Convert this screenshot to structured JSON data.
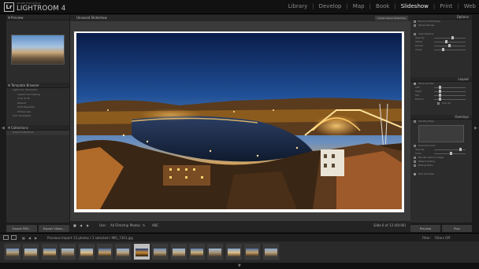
{
  "app": {
    "logo": "Lr",
    "brand_small": "ADOBE PHOTOSHOP",
    "brand": "LIGHTROOM 4",
    "modules": [
      "Library",
      "Develop",
      "Map",
      "Book",
      "Slideshow",
      "Print",
      "Web"
    ],
    "active_module": "Slideshow"
  },
  "left_panel": {
    "preview_header": "Preview",
    "template_browser_header": "Template Browser",
    "template_items": [
      "Lightroom Templates",
      "Caption and Rating",
      "Crop To Fill",
      "Default",
      "EXIF Metadata",
      "Widescreen",
      "User Templates"
    ],
    "collections_header": "Collections",
    "collection_items": [
      "Smart Collections"
    ],
    "export_pdf": "Export PDF...",
    "export_video": "Export Video..."
  },
  "center": {
    "title": "Unsaved Slideshow",
    "create_saved": "Create Saved Slideshow",
    "toolbar": {
      "use_label": "Use:",
      "use_value": "All Filmstrip Photos",
      "abc": "ABC",
      "slide_count": "Slide 6 of 13 (00:00)"
    }
  },
  "right_panel": {
    "header": "Options",
    "options": [
      "Zoom to Fill Frame",
      "Stroke Border",
      "Cast Shadow"
    ],
    "shadow_sliders": [
      "Opacity",
      "Offset",
      "Radius",
      "Angle"
    ],
    "layout_header": "Layout",
    "show_guides": "Show Guides",
    "guides": [
      "Left",
      "Right",
      "Top",
      "Bottom",
      "Link All"
    ],
    "overlays_header": "Overlays",
    "identity_plate": "Identity Plate",
    "override_color": "Override Color",
    "overlay_sliders": [
      "Opacity",
      "Scale"
    ],
    "render_behind": "Render behind image",
    "watermarking": "Watermarking",
    "rating_stars": "Rating Stars",
    "text_overlays": "Text Overlays",
    "preview_btn": "Preview",
    "play_btn": "Play"
  },
  "filmstrip": {
    "prev_import": "Previous Import",
    "info": "13 photos / 1 selected / IMG_7301.jpg",
    "filter_label": "Filter:",
    "filter_value": "Filters Off",
    "thumb_count": 15,
    "selected_index": 7
  },
  "colors": {
    "accent": "#f0f0f0",
    "panel": "#2c2c2c",
    "background": "#1b1b1b"
  }
}
